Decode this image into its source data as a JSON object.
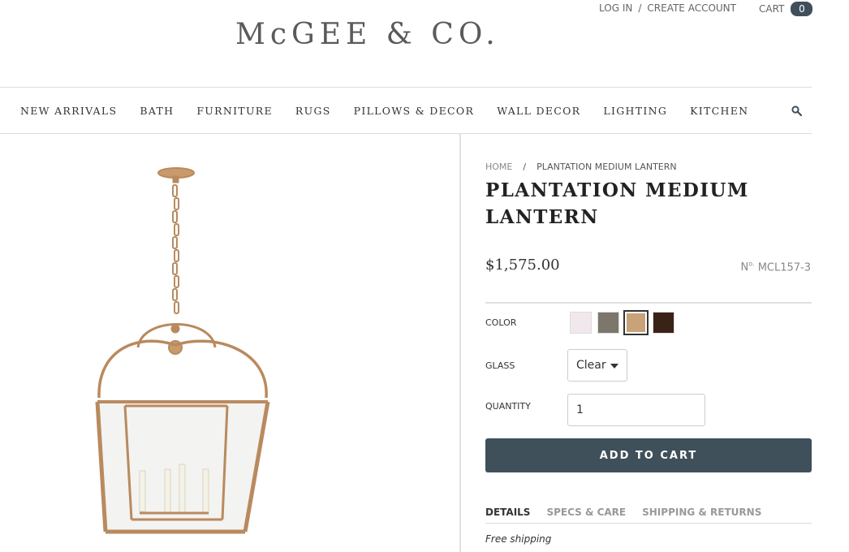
{
  "header": {
    "logo": "McGEE & CO.",
    "login": "LOG IN",
    "separator": "/",
    "create_account": "CREATE ACCOUNT",
    "cart_label": "CART",
    "cart_count": "0"
  },
  "nav": {
    "items": [
      "NEW ARRIVALS",
      "BATH",
      "FURNITURE",
      "RUGS",
      "PILLOWS & DECOR",
      "WALL DECOR",
      "LIGHTING",
      "KITCHEN"
    ],
    "search_icon": "search-icon"
  },
  "breadcrumb": {
    "home": "HOME",
    "separator": "/",
    "current": "PLANTATION MEDIUM LANTERN"
  },
  "product": {
    "title": "PLANTATION MEDIUM LANTERN",
    "price": "$1,575.00",
    "sku_prefix": "No.",
    "sku": "MCL157-3",
    "color_label": "COLOR",
    "colors": [
      "#f0e8ec",
      "#7d766b",
      "#c8a278",
      "#3a2217"
    ],
    "selected_color_index": 2,
    "glass_label": "GLASS",
    "glass_value": "Clear",
    "quantity_label": "QUANTITY",
    "quantity_value": "1",
    "add_to_cart": "ADD TO CART"
  },
  "tabs": {
    "details": "DETAILS",
    "specs": "SPECS & CARE",
    "shipping": "SHIPPING & RETURNS",
    "active": "DETAILS"
  },
  "details": {
    "free_shipping": "Free shipping"
  },
  "colors": {
    "brand_dark": "#3f505a",
    "brass": "#b98a5e"
  }
}
